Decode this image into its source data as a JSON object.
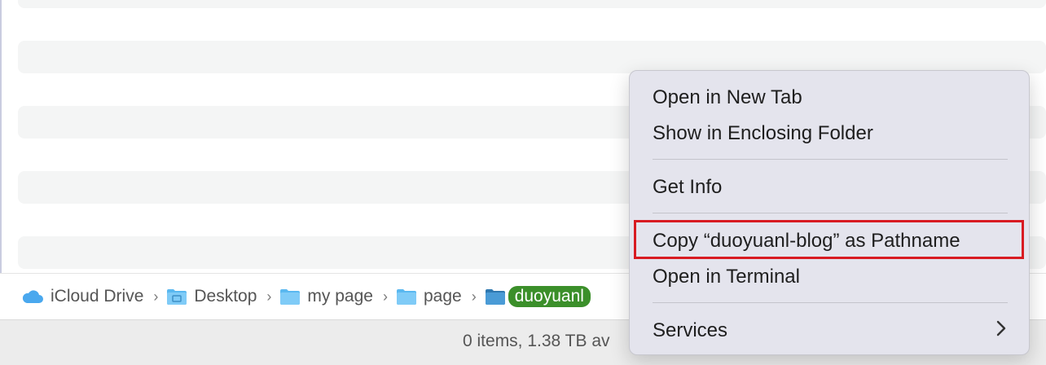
{
  "breadcrumb": {
    "items": [
      {
        "label": "iCloud Drive",
        "icon": "cloud-icon"
      },
      {
        "label": "Desktop",
        "icon": "desktop-folder-icon"
      },
      {
        "label": "my page",
        "icon": "folder-icon"
      },
      {
        "label": "page",
        "icon": "folder-icon"
      },
      {
        "label": "duoyuanl",
        "icon": "folder-icon",
        "highlighted": true
      }
    ],
    "separator": "›"
  },
  "status": {
    "text": "0 items, 1.38 TB av"
  },
  "context_menu": {
    "items": [
      {
        "label": "Open in New Tab"
      },
      {
        "label": "Show in Enclosing Folder"
      },
      {
        "label": "Get Info"
      },
      {
        "label": "Copy “duoyuanl-blog” as Pathname",
        "highlighted_box": true
      },
      {
        "label": "Open in Terminal"
      },
      {
        "label": "Services",
        "has_submenu": true
      }
    ]
  },
  "colors": {
    "highlight_badge": "#3b8f2a",
    "annotation_box": "#d81b22",
    "folder_blue": "#5ab8f0"
  }
}
